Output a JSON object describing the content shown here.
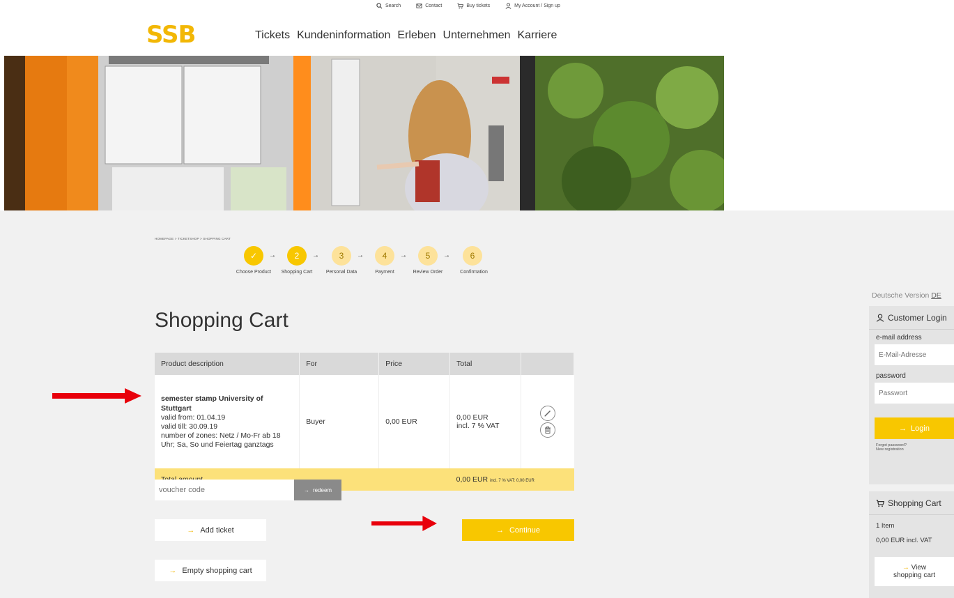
{
  "top_links": [
    {
      "label": "Search",
      "icon": "search-icon"
    },
    {
      "label": "Contact",
      "icon": "mail-icon"
    },
    {
      "label": "Buy tickets",
      "icon": "cart-icon"
    },
    {
      "label": "My Account / Sign up",
      "icon": "user-icon"
    }
  ],
  "logo": "SSB",
  "nav": [
    "Tickets",
    "Kundeninformation",
    "Erleben",
    "Unternehmen",
    "Karriere"
  ],
  "breadcrumb": "HOMEPAGE  >  TICKETSHOP  >  SHOPPING CART",
  "steps": [
    {
      "num": "✓",
      "label": "Choose Product"
    },
    {
      "num": "2",
      "label": "Shopping Cart"
    },
    {
      "num": "3",
      "label": "Personal Data"
    },
    {
      "num": "4",
      "label": "Payment"
    },
    {
      "num": "5",
      "label": "Review Order"
    },
    {
      "num": "6",
      "label": "Confirmation"
    }
  ],
  "page_title": "Shopping Cart",
  "table": {
    "headers": [
      "Product description",
      "For",
      "Price",
      "Total",
      ""
    ],
    "product": {
      "name": "semester stamp University of Stuttgart",
      "valid_from": "valid from: 01.04.19",
      "valid_till": "valid till: 30.09.19",
      "zones": "number of zones: Netz / Mo-Fr ab 18 Uhr; Sa, So und Feiertag ganztags",
      "for": "Buyer",
      "price": "0,00 EUR",
      "total": "0,00 EUR",
      "total_vat": "incl. 7 % VAT"
    },
    "total_label": "Total amount",
    "total_value": "0,00 EUR",
    "total_vat": "incl. 7 % VAT: 0,00 EUR"
  },
  "voucher": {
    "placeholder": "voucher code",
    "button": "redeem"
  },
  "buttons": {
    "add_ticket": "Add ticket",
    "continue": "Continue",
    "empty_cart": "Empty shopping cart"
  },
  "sidebar": {
    "language_prefix": "Deutsche Version ",
    "language_link": "DE",
    "login": {
      "title": "Customer Login",
      "email_label": "e-mail address",
      "email_placeholder": "E-Mail-Adresse",
      "password_label": "password",
      "password_placeholder": "Passwort",
      "login_button": "Login",
      "forgot": "Forgot password?",
      "register": "New registration"
    },
    "cart": {
      "title": "Shopping Cart",
      "items": "1 Item",
      "amount": "0,00 EUR incl. VAT",
      "view_line1": "View",
      "view_line2": "shopping cart"
    }
  },
  "colors": {
    "accent": "#f8c700",
    "accent_light": "#fce17a",
    "arrow_red": "#e8000b"
  }
}
